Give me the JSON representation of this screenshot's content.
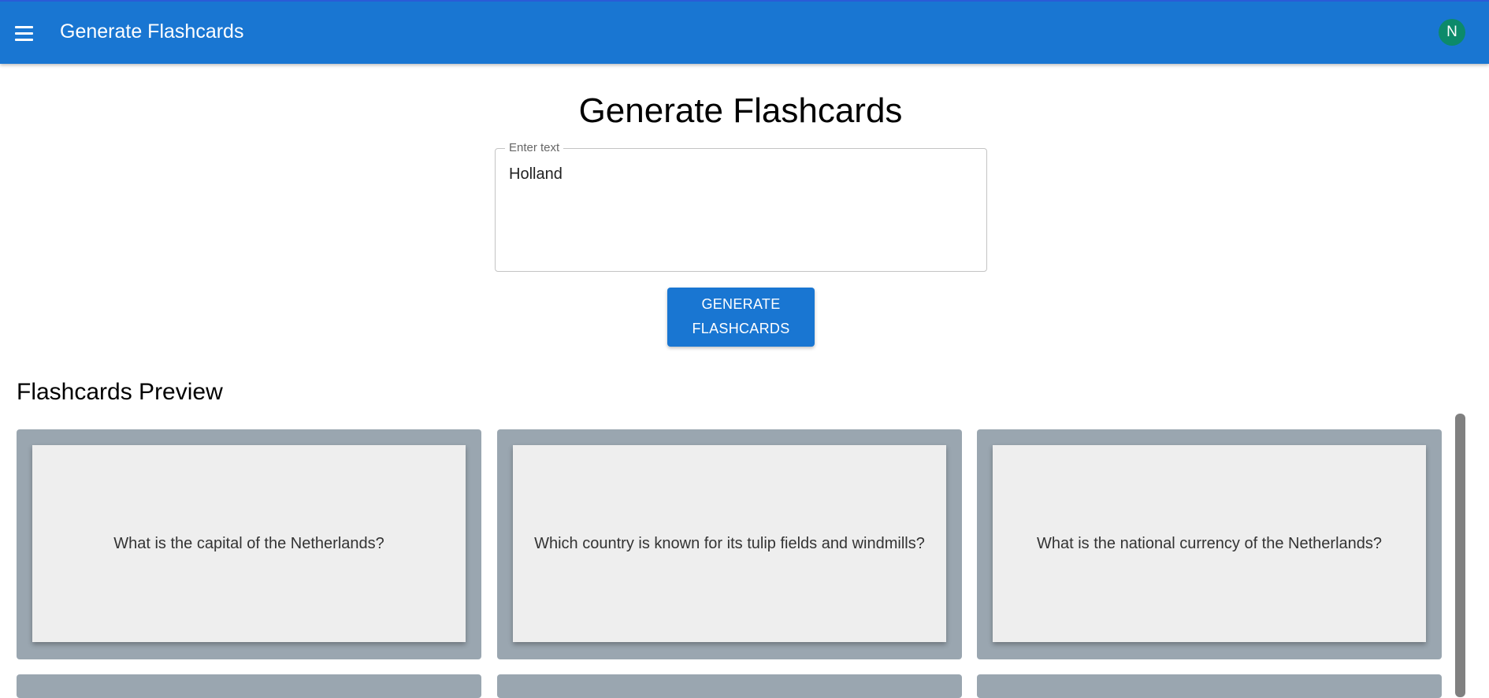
{
  "appbar": {
    "title": "Generate Flashcards",
    "menu_icon": "menu-icon",
    "avatar_letter": "N",
    "color": "#1976d2",
    "avatar_color": "#0c8a6a"
  },
  "main": {
    "title": "Generate Flashcards",
    "input": {
      "label": "Enter text",
      "value": "Holland"
    },
    "generate_button": {
      "line1": "GENERATE",
      "line2": "FLASHCARDS"
    }
  },
  "preview": {
    "title": "Flashcards Preview",
    "cards": [
      {
        "question": "What is the capital of the Netherlands?"
      },
      {
        "question": "Which country is known for its tulip fields and windmills?"
      },
      {
        "question": "What is the national currency of the Netherlands?"
      }
    ]
  }
}
